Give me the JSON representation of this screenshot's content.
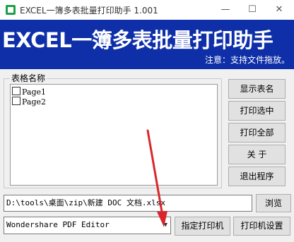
{
  "window": {
    "title": "EXCEL一簿多表批量打印助手  1.001",
    "minimize": "—",
    "maximize": "☐",
    "close": "✕"
  },
  "banner": {
    "title": "EXCEL一簿多表批量打印助手",
    "note": "注意：支持文件拖放。"
  },
  "sheets": {
    "group_label": "表格名称",
    "items": [
      {
        "label": "Page1",
        "checked": false
      },
      {
        "label": "Page2",
        "checked": false
      }
    ]
  },
  "buttons": {
    "show_names": "显示表名",
    "print_selected": "打印选中",
    "print_all": "打印全部",
    "about": "关  于",
    "exit": "退出程序",
    "browse": "浏览",
    "set_printer": "指定打印机",
    "printer_settings": "打印机设置"
  },
  "file": {
    "path": "D:\\tools\\桌面\\zip\\新建 DOC 文档.xlsx"
  },
  "printer": {
    "selected": "Wondershare PDF Editor",
    "arrow": "▼"
  },
  "colors": {
    "banner_bg": "#0f2fa8",
    "annotation_arrow": "#d9262c"
  }
}
